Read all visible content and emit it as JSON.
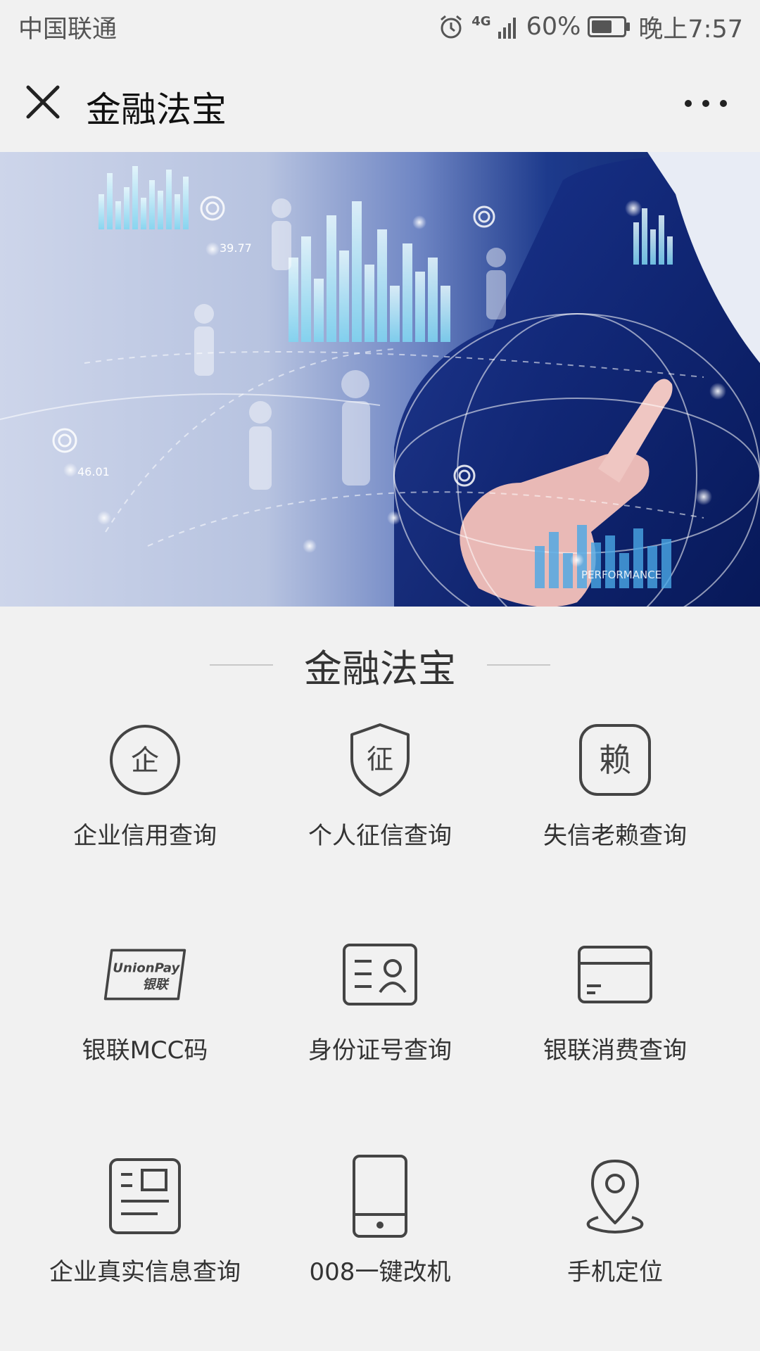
{
  "status_bar": {
    "carrier": "中国联通",
    "network": "4G",
    "battery": "60%",
    "time": "晚上7:57",
    "icons": [
      "alarm-icon",
      "signal-icon",
      "battery-icon"
    ]
  },
  "nav": {
    "title": "金融法宝",
    "close_icon": "close-icon",
    "more_icon": "more-icon"
  },
  "banner": {
    "label_1": "39.77",
    "label_2": "46.01",
    "label_3": "PERFORMANCE"
  },
  "section": {
    "title": "金融法宝"
  },
  "tiles": [
    {
      "label": "企业信用查询",
      "icon": "enterprise-circle-icon",
      "glyph": "企"
    },
    {
      "label": "个人征信查询",
      "icon": "credit-shield-icon",
      "glyph": "征"
    },
    {
      "label": "失信老赖查询",
      "icon": "defaulter-badge-icon",
      "glyph": "赖"
    },
    {
      "label": "银联MCC码",
      "icon": "unionpay-icon",
      "brand_line1": "UnionPay",
      "brand_line2": "银联"
    },
    {
      "label": "身份证号查询",
      "icon": "id-card-icon"
    },
    {
      "label": "银联消费查询",
      "icon": "bank-card-icon"
    },
    {
      "label": "企业真实信息查询",
      "icon": "document-info-icon"
    },
    {
      "label": "008一键改机",
      "icon": "phone-icon"
    },
    {
      "label": "手机定位",
      "icon": "location-pin-icon"
    }
  ],
  "colors": {
    "background": "#f1f1f1",
    "icon_stroke": "#444444",
    "banner_dark": "#0d2366",
    "banner_light": "#cdd5ea"
  }
}
